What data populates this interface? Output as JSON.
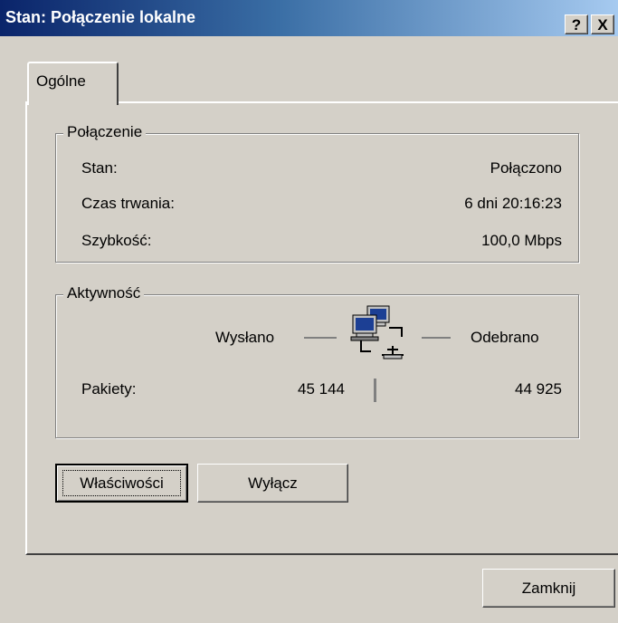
{
  "window": {
    "title": "Stan: Połączenie lokalne",
    "help_button": "?",
    "close_button": "X"
  },
  "tabs": [
    {
      "label": "Ogólne",
      "selected": true
    }
  ],
  "connection": {
    "legend": "Połączenie",
    "rows": [
      {
        "label": "Stan:",
        "value": "Połączono"
      },
      {
        "label": "Czas trwania:",
        "value": "6 dni 20:16:23"
      },
      {
        "label": "Szybkość:",
        "value": "100,0 Mbps"
      }
    ]
  },
  "activity": {
    "legend": "Aktywność",
    "sent_label": "Wysłano",
    "received_label": "Odebrano",
    "packets_label": "Pakiety:",
    "packets_sent": "45 144",
    "packets_received": "44 925",
    "icon": "network-computers-icon"
  },
  "buttons": {
    "properties_label": "Właściwości",
    "disable_label": "Wyłącz",
    "close_label": "Zamknij"
  }
}
